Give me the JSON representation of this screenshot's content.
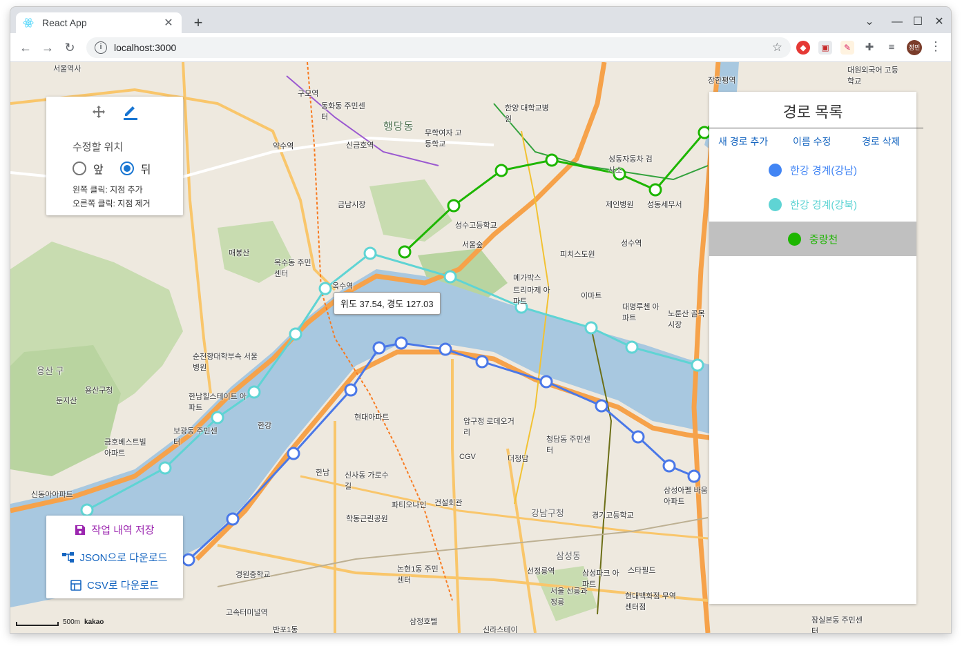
{
  "browser": {
    "tab_title": "React App",
    "tab_close": "✕",
    "new_tab": "+",
    "url": "localhost:3000",
    "avatar_text": "정민",
    "window_controls": [
      "⌄",
      "—",
      "☐",
      "✕"
    ]
  },
  "edit_panel": {
    "title": "수정할 위치",
    "options": [
      "앞",
      "뒤"
    ],
    "selected": "뒤",
    "hint_left": "왼쪽 클릭: 지점 추가",
    "hint_right": "오른쪽 클릭: 지점 제거"
  },
  "save_panel": {
    "save": "작업 내역 저장",
    "json": "JSON으로 다운로드",
    "csv": "CSV로 다운로드"
  },
  "route_panel": {
    "title": "경로 목록",
    "buttons": [
      "새 경로 추가",
      "이름 수정",
      "경로 삭제"
    ],
    "routes": [
      {
        "name": "한강 경계(강남)",
        "color": "#4285f4",
        "selected": false
      },
      {
        "name": "한강 경계(강북)",
        "color": "#5fd4d4",
        "selected": false
      },
      {
        "name": "중랑천",
        "color": "#1db600",
        "selected": true
      }
    ]
  },
  "tooltip": "위도 37.54, 경도 127.03",
  "scale": {
    "label": "500m",
    "brand": "kakao"
  },
  "map_labels": [
    "서울역사",
    "용산구청",
    "용산 구",
    "둔지산",
    "한남힐스테이트 아파트",
    "보광동 주민센터",
    "순천향대학부속 서울병원",
    "옥수역",
    "금남시장",
    "성수역",
    "서울숲",
    "메가박스",
    "트리마제 아파트",
    "현대아파트",
    "압구정 로데오거리",
    "CGV",
    "신사동 가로수길",
    "강남구청",
    "청담동 주민센터",
    "더청담",
    "건설회관",
    "파티오나인",
    "학동근린공원",
    "삼성파크 아파트",
    "서울 선릉과정릉",
    "선정릉역",
    "삼성동",
    "현대백화점 무역센터점",
    "경기고등학교",
    "스타필드",
    "삼성아펠 바움아파트",
    "한양 대학교병원",
    "성수고등학교",
    "제인병원",
    "성동자동차 검사소",
    "성동세무서",
    "피치스도원",
    "이마트",
    "대명루첸 아파트",
    "노룬산 골목시장",
    "장한평역",
    "대원외국어 고등학교",
    "한강",
    "잠실본동 주민센터",
    "신라스테이",
    "삼정호텔",
    "반포1동",
    "경원중학교",
    "고속터미널역",
    "논현1동 주민센터",
    "신동아아파트",
    "한남",
    "금호베스트빌 아파트",
    "약수역",
    "구모역",
    "동화동 주민센터",
    "신금호역",
    "무학여자 고등학교",
    "행당동",
    "옥수동 주민센터",
    "매봉산"
  ]
}
